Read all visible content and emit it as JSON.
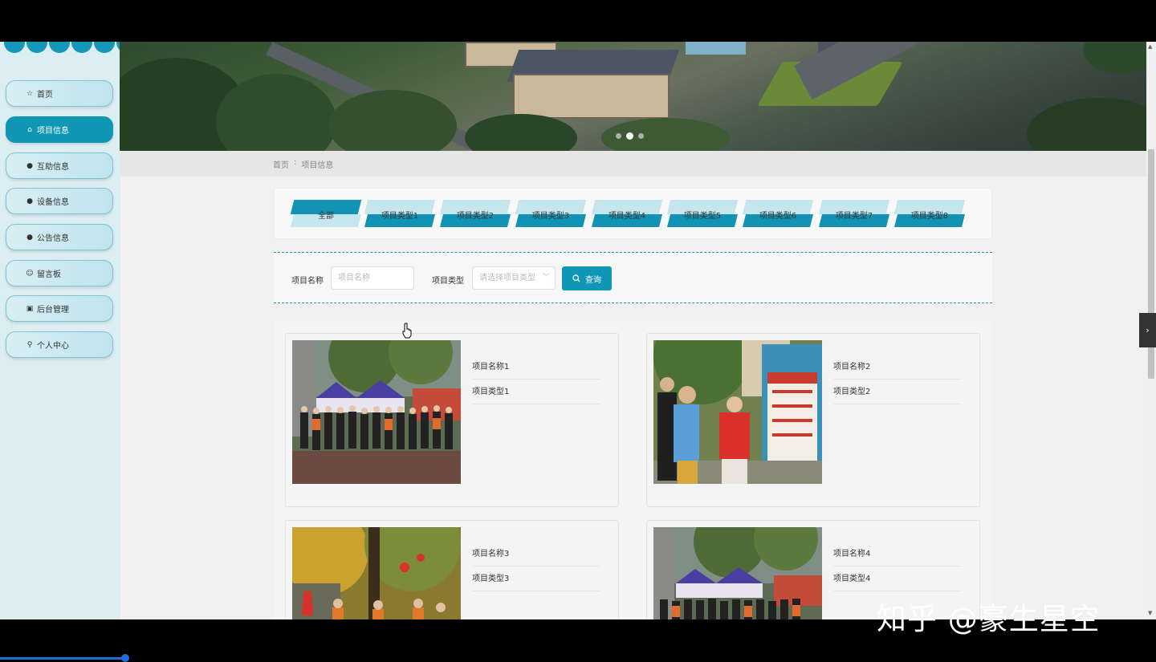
{
  "sidebar": {
    "items": [
      {
        "label": "首页",
        "icon": "star-icon",
        "glyph": "☆"
      },
      {
        "label": "项目信息",
        "icon": "bag-icon",
        "glyph": "⌂"
      },
      {
        "label": "互助信息",
        "icon": "alert-icon",
        "glyph": "●"
      },
      {
        "label": "设备信息",
        "icon": "question-icon",
        "glyph": "●"
      },
      {
        "label": "公告信息",
        "icon": "info-icon",
        "glyph": "●"
      },
      {
        "label": "留言板",
        "icon": "smile-icon",
        "glyph": "☺"
      },
      {
        "label": "后台管理",
        "icon": "briefcase-icon",
        "glyph": "▣"
      },
      {
        "label": "个人中心",
        "icon": "user-icon",
        "glyph": "⚲"
      }
    ],
    "active_index": 1,
    "accent": "#0f97b5"
  },
  "breadcrumb": {
    "home": "首页",
    "separator": ":",
    "current": "项目信息"
  },
  "categories": [
    {
      "label": "全部",
      "active": true
    },
    {
      "label": "项目类型1"
    },
    {
      "label": "项目类型2"
    },
    {
      "label": "项目类型3"
    },
    {
      "label": "项目类型4"
    },
    {
      "label": "项目类型5"
    },
    {
      "label": "项目类型6"
    },
    {
      "label": "项目类型7"
    },
    {
      "label": "项目类型8"
    }
  ],
  "search": {
    "name_label": "项目名称",
    "name_placeholder": "项目名称",
    "type_label": "项目类型",
    "type_placeholder": "请选择项目类型",
    "button_label": "查询"
  },
  "items": [
    {
      "name": "项目名称1",
      "type": "项目类型1"
    },
    {
      "name": "项目名称2",
      "type": "项目类型2"
    },
    {
      "name": "项目名称3",
      "type": "项目类型3"
    },
    {
      "name": "项目名称4",
      "type": "项目类型4"
    }
  ],
  "watermark": "知乎 @豪生星空"
}
